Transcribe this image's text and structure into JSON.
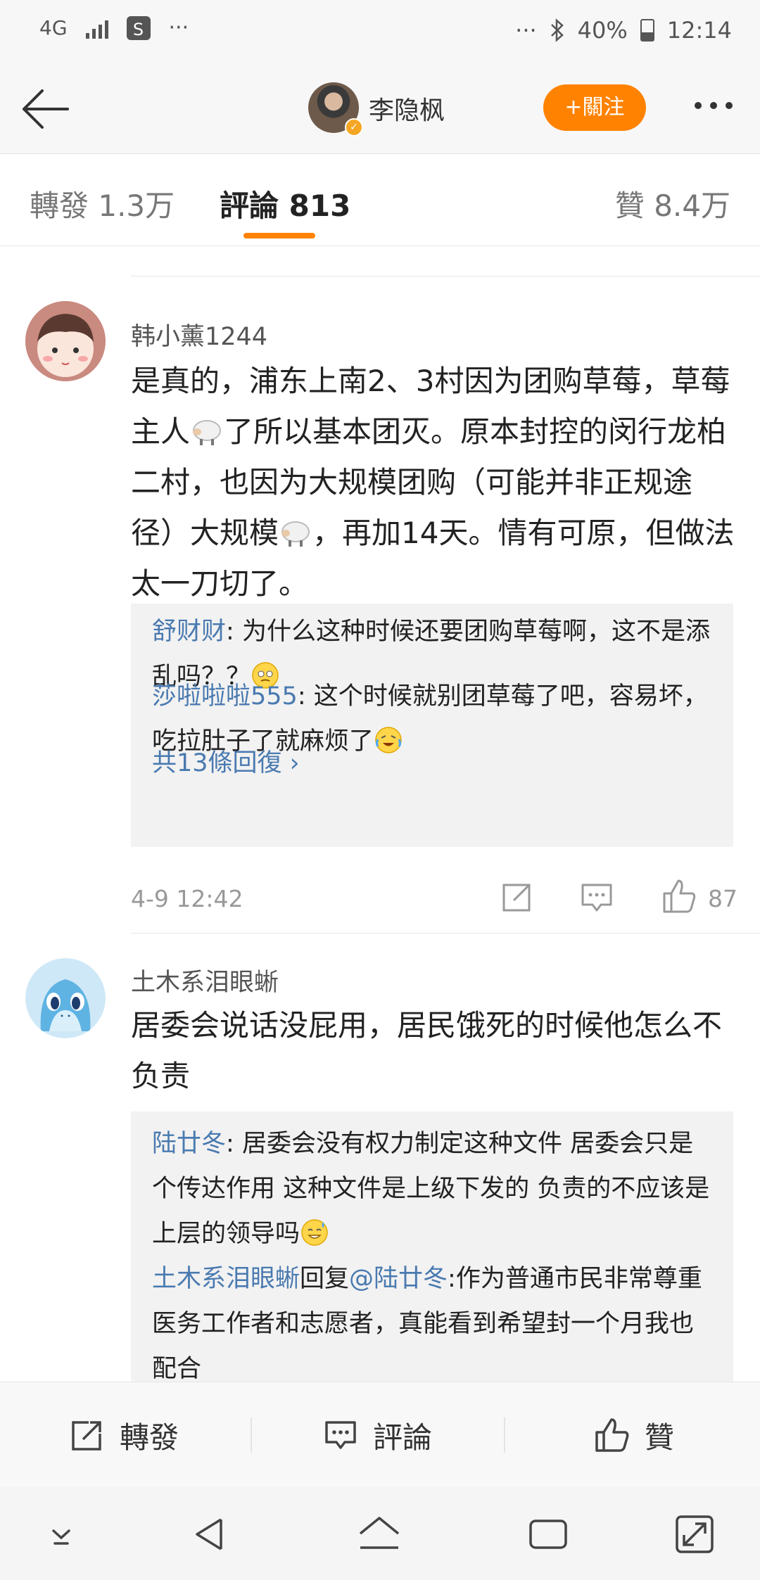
{
  "status_bar": {
    "network": "4G",
    "dots_left": "···",
    "dots_right": "···",
    "battery": "40%",
    "time": "12:14"
  },
  "header": {
    "username": "李隐枫",
    "follow_label": "+關注"
  },
  "tabs": {
    "repost": "轉發 1.3万",
    "comments": "評論 813",
    "likes": "贊 8.4万"
  },
  "comments": [
    {
      "username": "韩小薰1244",
      "text_parts": [
        "是真的，浦东上南2、3村因为团购草莓，草莓主人",
        "了所以基本团灭。原本封控的闵行龙柏二村，也因为大规模团购（可能并非正规途径）大规模",
        "，再加14天。情有可原，但做法太一刀切了。"
      ],
      "replies": [
        {
          "name": "舒财财",
          "sep": ": ",
          "text": "为什么这种时候还要团购草莓啊，这不是添乱吗？？"
        },
        {
          "name": "莎啦啦啦555",
          "sep": ": ",
          "text": "这个时候就别团草莓了吧，容易坏，吃拉肚子了就麻烦了"
        }
      ],
      "more_replies": "共13條回復 ›",
      "time": "4-9 12:42",
      "likes": "87"
    },
    {
      "username": "土木系泪眼蜥",
      "text": "居委会说话没屁用，居民饿死的时候他怎么不负责",
      "replies": [
        {
          "name": "陆廿冬",
          "sep": ": ",
          "text": "居委会没有权力制定这种文件 居委会只是个传达作用 这种文件是上级下发的 负责的不应该是上层的领导吗"
        },
        {
          "name": "土木系泪眼蜥",
          "mid": "回复",
          "mention": "@陆廿冬",
          "sep": ":",
          "text": "作为普通市民非常尊重医务工作者和志愿者，真能看到希望封一个月我也配合"
        }
      ]
    }
  ],
  "action_bar": {
    "repost": "轉發",
    "comment": "評論",
    "like": "贊"
  },
  "colors": {
    "accent": "#ff8200",
    "link": "#4a7ab0"
  }
}
